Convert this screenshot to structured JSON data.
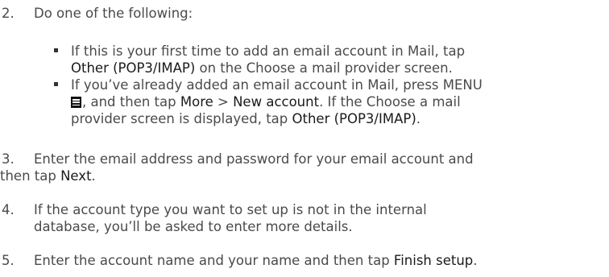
{
  "steps": [
    {
      "number": "2.",
      "text": "Do one of the following:"
    },
    {
      "number": "3.",
      "line1": "Enter the email address and password for your email account and",
      "line2_prefix": "then tap ",
      "line2_link": "Next",
      "line2_suffix": "."
    },
    {
      "number": "4.",
      "line1": "If the account type you want to set up is not in the internal",
      "line2": "database, you’ll be asked to enter more details."
    },
    {
      "number": "5.",
      "prefix": "Enter the account name and your name and then tap ",
      "link": "Finish setup",
      "suffix": "."
    }
  ],
  "bullets": [
    {
      "line1": "If this is your first time to add an email account in Mail, tap",
      "line2_link": "Other (POP3/IMAP)",
      "line2_suffix": " on the Choose a mail provider screen."
    },
    {
      "line1": "If you’ve already added an email account in Mail, press MENU",
      "line2_suffix": ", and then tap ",
      "line2_link_more": "More",
      "line2_sep": " > ",
      "line2_link_new": "New account",
      "line2_tail": ". If the Choose a mail",
      "line3_prefix": "provider screen is displayed, tap ",
      "line3_link": "Other (POP3/IMAP)",
      "line3_suffix": "."
    }
  ],
  "icons": {
    "menu": "menu-icon"
  }
}
